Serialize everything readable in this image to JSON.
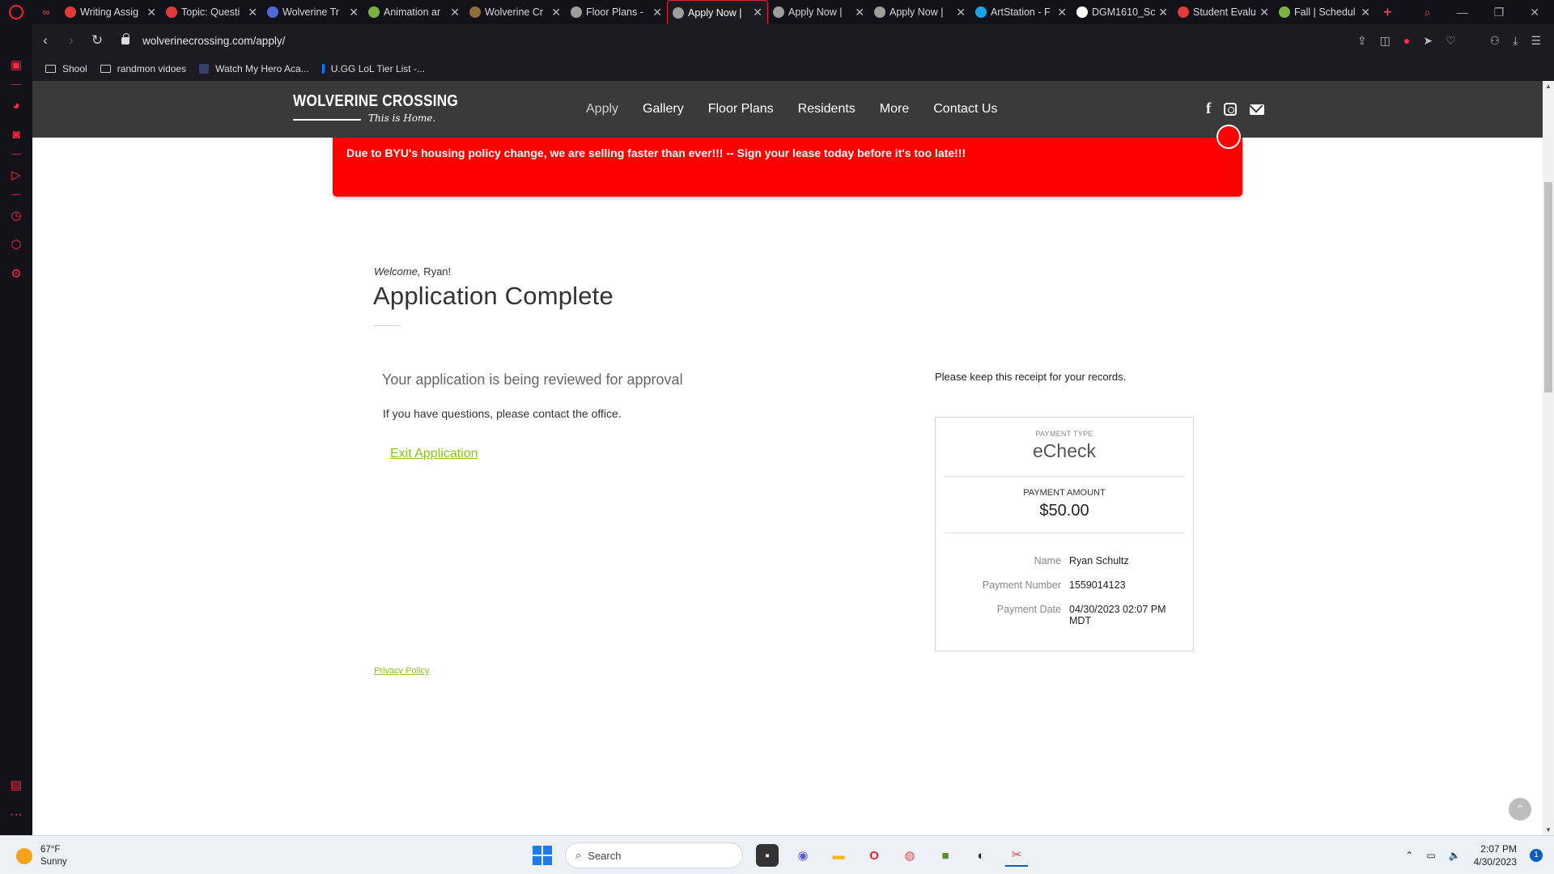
{
  "browser": {
    "tabs": [
      {
        "title": "Writing Assig",
        "color": "#e23a3a"
      },
      {
        "title": "Topic: Questi",
        "color": "#e23a3a"
      },
      {
        "title": "Wolverine Tr",
        "color": "#4f6bd8"
      },
      {
        "title": "Animation ar",
        "color": "#7cb342"
      },
      {
        "title": "Wolverine Cr",
        "color": "#8d6e3a"
      },
      {
        "title": "Floor Plans -",
        "color": "#9e9e9e"
      },
      {
        "title": "Apply Now | ",
        "color": "#9e9e9e",
        "active": true
      },
      {
        "title": "Apply Now | ",
        "color": "#9e9e9e"
      },
      {
        "title": "Apply Now | ",
        "color": "#9e9e9e"
      },
      {
        "title": "ArtStation - F",
        "color": "#1aa3e8"
      },
      {
        "title": "DGM1610_Sc",
        "color": "#ffffff"
      },
      {
        "title": "Student Evalu",
        "color": "#e23a3a"
      },
      {
        "title": "Fall | Schedul",
        "color": "#7cb342"
      }
    ],
    "url": "wolverinecrossing.com/apply/",
    "bookmarks": [
      {
        "label": "Shool",
        "type": "folder"
      },
      {
        "label": "randmon vidoes",
        "type": "folder"
      },
      {
        "label": "Watch My Hero Aca...",
        "type": "site"
      },
      {
        "label": "U.GG LoL Tier List -...",
        "type": "site"
      }
    ]
  },
  "site": {
    "logo_name": "WOLVERINE CROSSING",
    "logo_tagline": "This is Home.",
    "nav": [
      "Apply",
      "Gallery",
      "Floor Plans",
      "Residents",
      "More",
      "Contact Us"
    ],
    "alert": "Due to BYU's housing policy change, we are selling faster than ever!!! -- Sign your lease today before it's too late!!!"
  },
  "main": {
    "welcome_prefix": "Welcome,",
    "welcome_name": "Ryan!",
    "title": "Application Complete",
    "review_text": "Your application is being reviewed for approval",
    "questions_text": "If you have questions, please contact the office.",
    "exit_label": "Exit Application",
    "privacy_label": "Privacy Policy"
  },
  "receipt": {
    "keep_note": "Please keep this receipt for your records.",
    "payment_type_label": "PAYMENT TYPE",
    "payment_type": "eCheck",
    "payment_amount_label": "PAYMENT AMOUNT",
    "payment_amount": "$50.00",
    "name_label": "Name",
    "name": "Ryan Schultz",
    "number_label": "Payment Number",
    "number": "1559014123",
    "date_label": "Payment Date",
    "date": "04/30/2023 02:07 PM MDT"
  },
  "taskbar": {
    "temperature": "67°F",
    "condition": "Sunny",
    "search_placeholder": "Search",
    "time": "2:07 PM",
    "date": "4/30/2023",
    "notifications": "1"
  },
  "colors": {
    "alert_red": "#ff0000",
    "link_green": "#8cc21c",
    "header_gray": "#3a3a3a",
    "opera_red": "#ff1b2d"
  }
}
